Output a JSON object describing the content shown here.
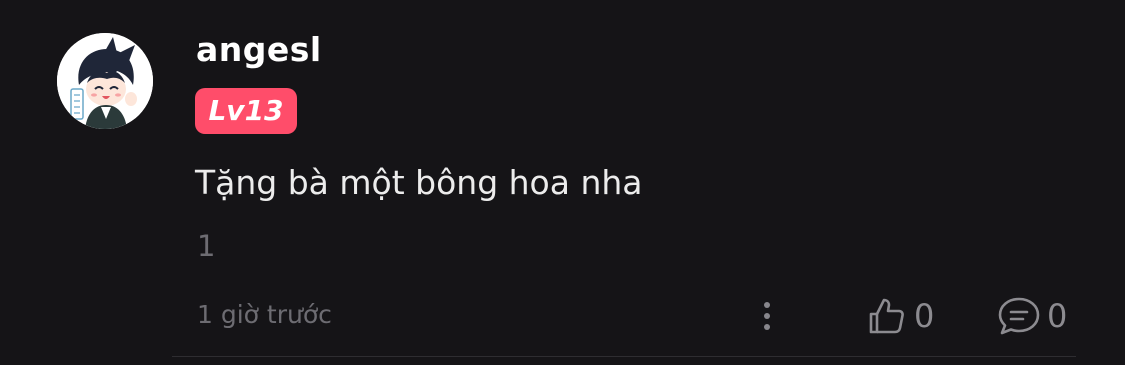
{
  "comment": {
    "username": "angesl",
    "level": "Lv13",
    "text": "Tặng bà một bông hoa nha",
    "reply_count": "1",
    "timestamp": "1 giờ trước",
    "like_count": "0",
    "comment_count": "0"
  },
  "icons": {
    "more": "more-vertical-icon",
    "like": "thumbs-up-icon",
    "reply": "speech-bubble-icon"
  },
  "colors": {
    "background": "#151417",
    "level_badge": "#ff4d6a",
    "text_primary": "#ffffff",
    "text_secondary": "#6d6c72"
  }
}
